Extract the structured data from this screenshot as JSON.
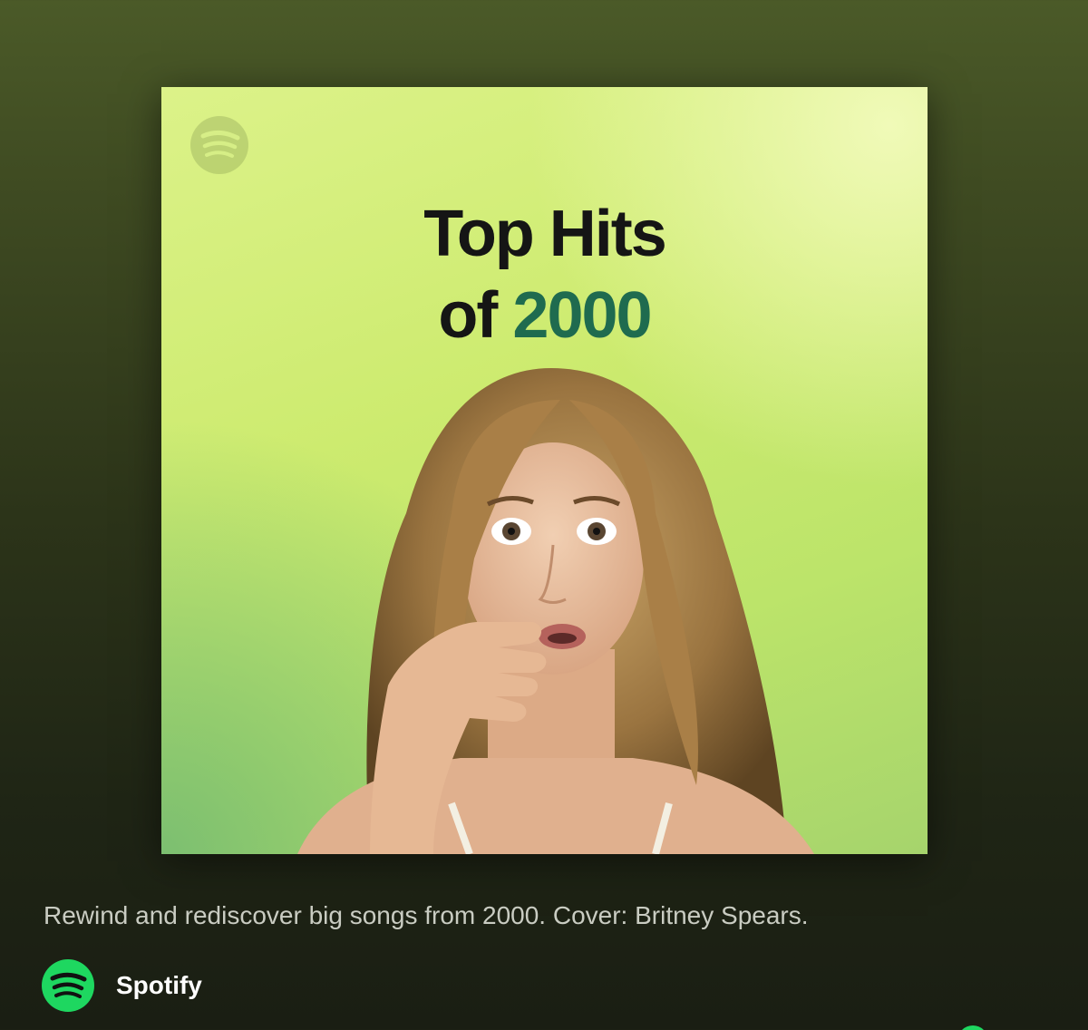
{
  "cover": {
    "title_line1": "Top Hits",
    "title_of": "of",
    "title_year": "2000",
    "logo_icon": "spotify-logo-icon",
    "image_subject": "Britney Spears portrait"
  },
  "playlist": {
    "description": "Rewind and rediscover big songs from 2000. Cover: Britney Spears.",
    "owner_name": "Spotify",
    "owner_icon": "spotify-logo-icon"
  },
  "colors": {
    "spotify_green": "#1ed760",
    "year_green": "#1f6b4f",
    "background_top": "#4b5a28",
    "background_bottom": "#1a1e13"
  }
}
